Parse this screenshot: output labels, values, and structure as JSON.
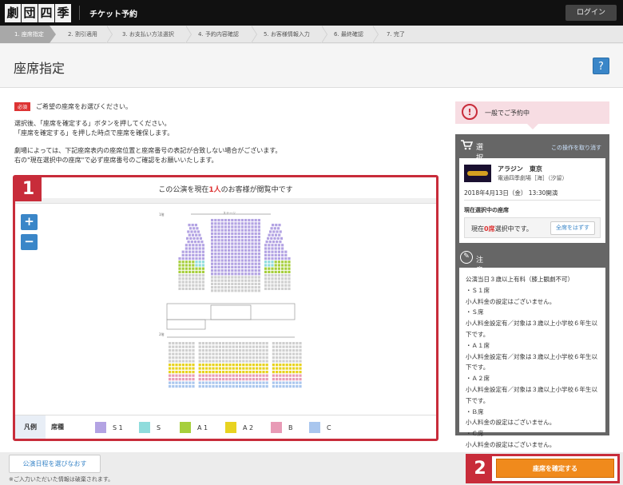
{
  "header": {
    "logo": [
      "劇",
      "団",
      "四",
      "季"
    ],
    "app_title": "チケット予約",
    "login_label": "ログイン"
  },
  "steps": [
    "1. 座席指定",
    "2. 割引適用",
    "3. お支払い方法選択",
    "4. 予約内容確認",
    "5. お客様情報入力",
    "6. 最終確認",
    "7. 完了"
  ],
  "page": {
    "title": "座席指定",
    "help_label": "?",
    "required_badge": "必須",
    "required_text": "ご希望の座席をお選びください。",
    "info1": [
      "選択後、「座席を確定する」ボタンを押してください。",
      "「座席を確定する」を押した時点で座席を確保します。"
    ],
    "info2": [
      "劇場によっては、下記座席表内の座席位置と座席番号の表記が合致しない場合がございます。",
      "右の\"現在選択中の座席\"で必ず座席番号のご確認をお願いいたします。"
    ]
  },
  "seatmap": {
    "badge": "1",
    "viewer_prefix": "この公演を現在",
    "viewer_count": "1人",
    "viewer_suffix": "のお客様が閲覧中です",
    "zoom_in": "+",
    "zoom_out": "−",
    "stage_label": "ステージ",
    "floor1_label": "1階",
    "floor2_label": "2階",
    "legend_head": "凡例",
    "legend_kind": "席種",
    "legend": [
      {
        "label": "S 1",
        "color": "#b3a3e3"
      },
      {
        "label": "S",
        "color": "#8fdcdc"
      },
      {
        "label": "A 1",
        "color": "#a6cf3c"
      },
      {
        "label": "A 2",
        "color": "#e8d320"
      },
      {
        "label": "B",
        "color": "#e89bb6"
      },
      {
        "label": "C",
        "color": "#a9c6ee"
      }
    ]
  },
  "sidebar": {
    "status": "一般でご予約中",
    "selected_title": "選択中の内容",
    "undo_link": "この操作を取り消す",
    "show_title": "アラジン　東京",
    "show_venue": "電通四季劇場［海］（汐留）",
    "show_date": "2018年4月13日（金） 13:30開演",
    "selected_seats_head": "現在選択中の座席",
    "selected_prefix": "現在",
    "selected_count": "0席",
    "selected_suffix": "選択中です。",
    "clear_button": "全席をはずす",
    "notes_title": "注意事項",
    "notes": "公演当日３歳以上有料（膝上観劇不可）\n・Ｓ１席\n小人料金の設定はございません。\n・Ｓ席\n小人料金設定有／対象は３歳以上小学校６年生以下です。\n・Ａ１席\n小人料金設定有／対象は３歳以上小学校６年生以下です。\n・Ａ２席\n小人料金設定有／対象は３歳以上小学校６年生以下です。\n・Ｂ席\n小人料金の設定はございません。\n・Ｃ席\n小人料金の設定はございません。"
  },
  "footer": {
    "back_button": "公演日程を選びなおす",
    "note": "※ご入力いただいた情報は破棄されます。",
    "badge": "2",
    "confirm_button": "座席を確定する"
  }
}
